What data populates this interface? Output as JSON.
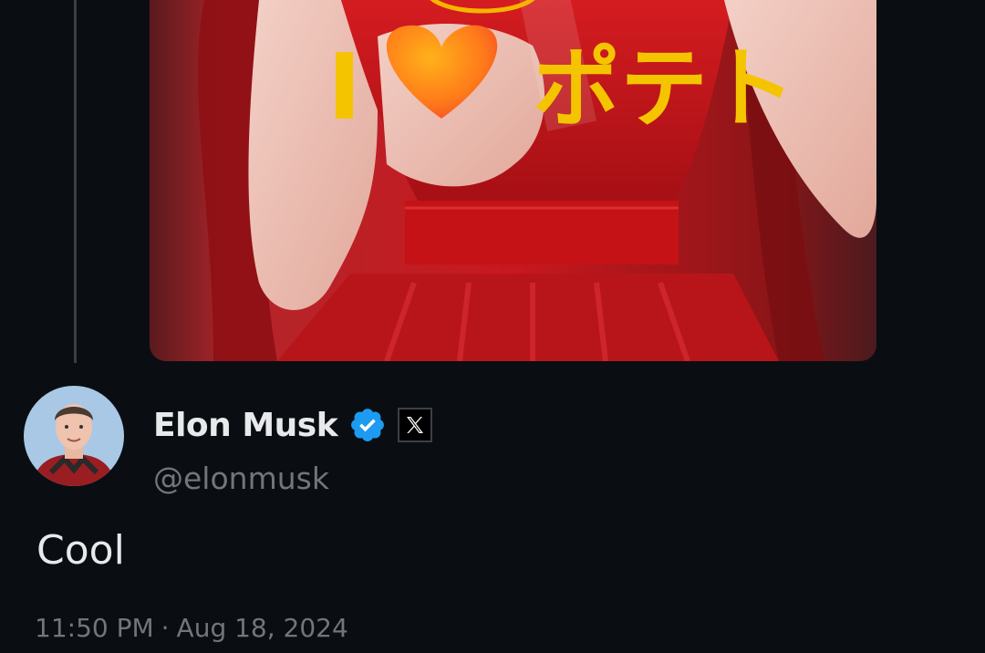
{
  "media": {
    "overlay_prefix": "I",
    "overlay_suffix": "ポテト"
  },
  "tweet": {
    "author": {
      "display_name": "Elon Musk",
      "handle": "@elonmusk",
      "verified": true,
      "affiliate_badge_glyph": "𝕏"
    },
    "text": "Cool",
    "time": "11:50 PM",
    "separator": "·",
    "date": "Aug 18, 2024"
  },
  "colors": {
    "background": "#0a0e13",
    "text_primary": "#e7e9ea",
    "text_secondary": "#71767b",
    "verified_blue": "#1d9bf0",
    "overlay_yellow": "#f5c400"
  },
  "icons": {
    "verified": "verified-badge-icon",
    "affiliate": "x-logo-icon"
  }
}
